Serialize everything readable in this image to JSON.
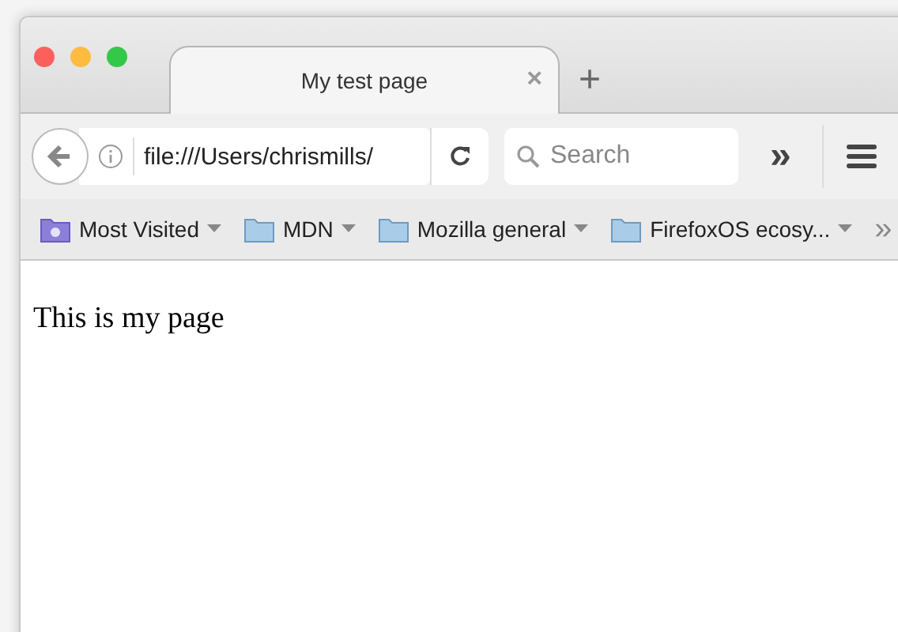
{
  "tabs": [
    {
      "title": "My test page",
      "close": "×",
      "selected": true
    }
  ],
  "new_tab": "+",
  "toolbar": {
    "url": "file:///Users/chrismills/",
    "search": {
      "placeholder": "Search"
    },
    "overflow": "»"
  },
  "bookmarks": [
    {
      "label": "Most Visited",
      "kind": "smart"
    },
    {
      "label": "MDN",
      "kind": "folder"
    },
    {
      "label": "Mozilla general",
      "kind": "folder"
    },
    {
      "label": "FirefoxOS ecosy...",
      "kind": "folder"
    }
  ],
  "bookmarks_overflow": "»",
  "content": {
    "text": "This is my page"
  }
}
